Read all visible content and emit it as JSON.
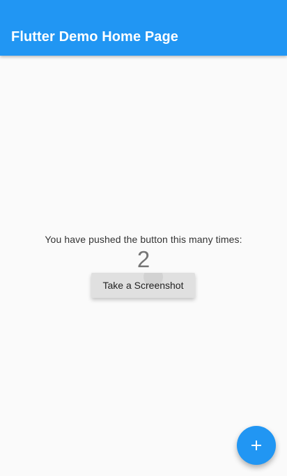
{
  "app_bar": {
    "title": "Flutter Demo Home Page",
    "color": "#2196f3"
  },
  "main": {
    "message": "You have pushed the button this many times:",
    "counter": "2",
    "screenshot_button_label": "Take a Screenshot"
  },
  "fab": {
    "icon": "plus-icon",
    "color": "#2196f3"
  }
}
